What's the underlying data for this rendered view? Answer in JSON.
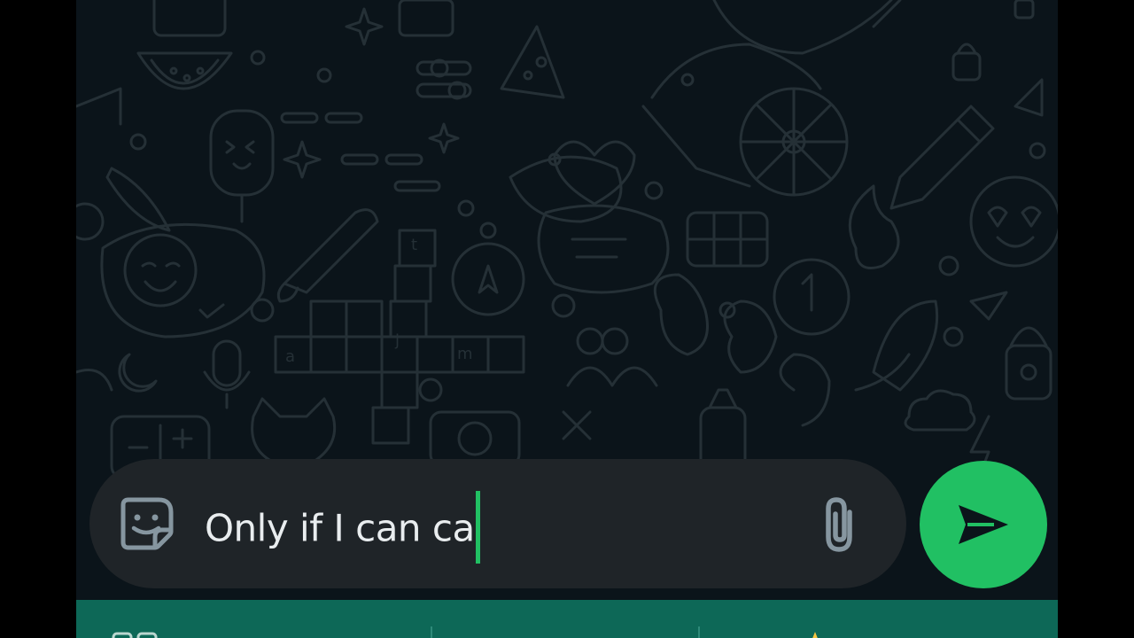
{
  "composer": {
    "message_text": "Only if I can ca",
    "sticker_icon": "sticker-icon",
    "attach_icon": "paperclip-icon"
  },
  "send_button": {
    "icon": "send-arrow-icon"
  },
  "keyboard_bar": {
    "left_icon": "keyboard-icon",
    "right_icon": "emoji-icon"
  },
  "colors": {
    "wallpaper_bg": "#0b141a",
    "wallpaper_doodle": "#253036",
    "composer_bg": "#1f2428",
    "accent_green": "#21c063",
    "caret": "#21c063",
    "text": "#e9edef",
    "icon_gray": "#8696a0",
    "bottom_bar": "#0d6857"
  }
}
